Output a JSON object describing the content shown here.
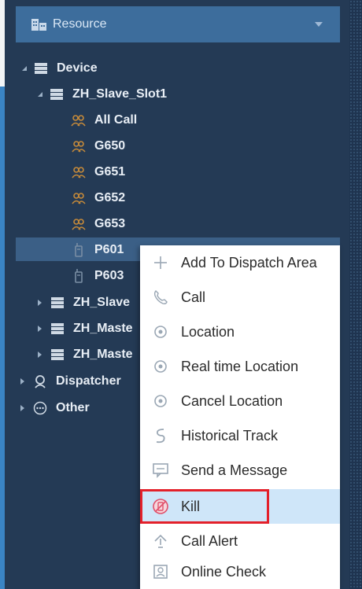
{
  "header": {
    "title": "Resource"
  },
  "tree": {
    "device": "Device",
    "slot1": "ZH_Slave_Slot1",
    "all_call": "All Call",
    "groups": [
      "G650",
      "G651",
      "G652",
      "G653"
    ],
    "terminals": [
      "P601",
      "P603"
    ],
    "collapsed": [
      "ZH_Slave",
      "ZH_Maste",
      "ZH_Maste"
    ],
    "dispatcher": "Dispatcher",
    "other": "Other"
  },
  "menu": {
    "items": [
      "Add To Dispatch Area",
      "Call",
      "Location",
      "Real time Location",
      "Cancel Location",
      "Historical Track",
      "Send a Message",
      "Kill",
      "Call Alert",
      "Online Check"
    ]
  },
  "colors": {
    "panel": "#243a55",
    "header": "#3d6d9c",
    "selected_row": "#3b5f86",
    "menu_highlight": "#cfe6f9",
    "kill_outline": "#e3202a"
  }
}
